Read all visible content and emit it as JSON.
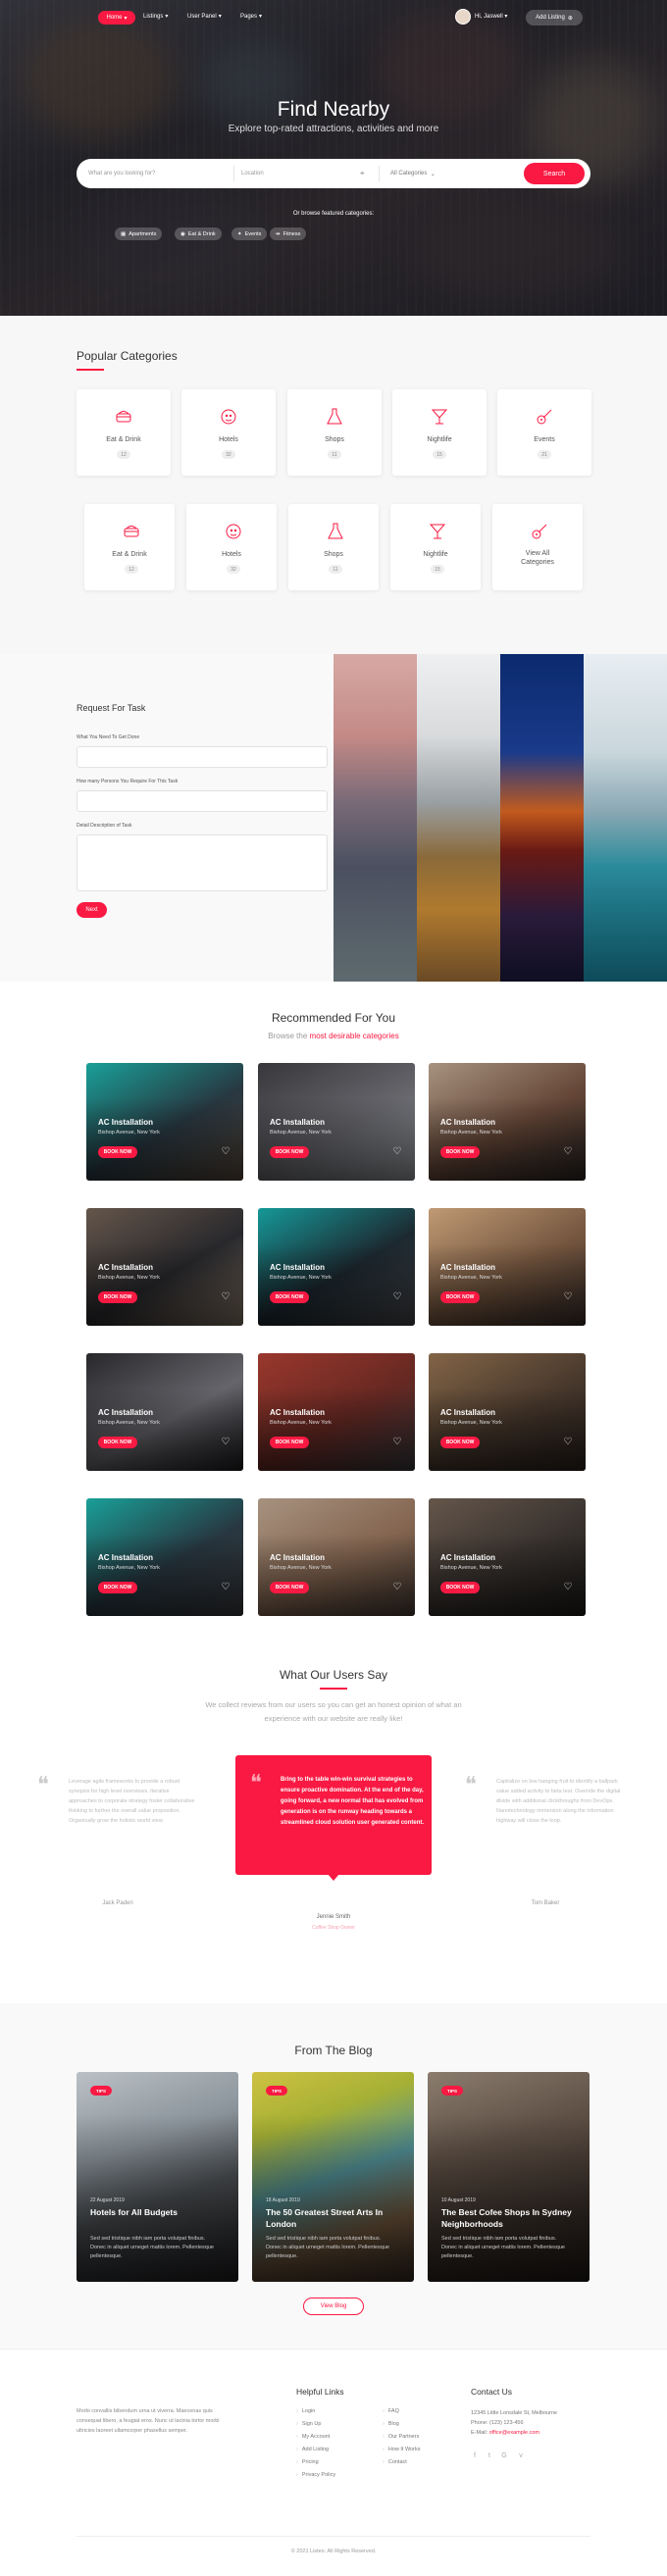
{
  "nav": {
    "home": "Home",
    "items": [
      "Listings",
      "User Panel",
      "Pages"
    ],
    "user": "Hi, Jaswell",
    "add_listing": "Add Listing"
  },
  "hero": {
    "title": "Find Nearby",
    "subtitle": "Explore top-rated attractions, activities and more",
    "search_placeholder": "What are you looking for?",
    "location_placeholder": "Location",
    "category_select": "All Categories",
    "search_button": "Search",
    "browse_label": "Or browse featured categories:",
    "chips": [
      "Apartments",
      "Eat & Drink",
      "Events",
      "Fitness"
    ]
  },
  "categories": {
    "title": "Popular Categories",
    "row1": [
      {
        "label": "Eat & Drink",
        "count": "12",
        "icon": "food-icon"
      },
      {
        "label": "Hotels",
        "count": "32",
        "icon": "hotel-icon"
      },
      {
        "label": "Shops",
        "count": "11",
        "icon": "shop-icon"
      },
      {
        "label": "Nightlife",
        "count": "15",
        "icon": "cocktail-icon"
      },
      {
        "label": "Events",
        "count": "21",
        "icon": "guitar-icon"
      }
    ],
    "row2": [
      {
        "label": "Eat & Drink",
        "count": "12",
        "icon": "food-icon"
      },
      {
        "label": "Hotels",
        "count": "32",
        "icon": "hotel-icon"
      },
      {
        "label": "Shops",
        "count": "11",
        "icon": "shop-icon"
      },
      {
        "label": "Nightlife",
        "count": "15",
        "icon": "cocktail-icon"
      },
      {
        "label": "View All Categories",
        "count": "",
        "icon": "guitar-icon"
      }
    ]
  },
  "request": {
    "title": "Request For Task",
    "field1_label": "What You Need To Get Done",
    "field2_label": "How many Persons You Require For This Task",
    "field3_label": "Detail Description of Task",
    "next": "Next"
  },
  "recommended": {
    "title": "Recommended For You",
    "subtitle_plain": "Browse the",
    "subtitle_em": "most desirable categories",
    "card_title": "AC Installation",
    "card_location": "Bishop Avenue, New York",
    "card_button": "BOOK NOW"
  },
  "testimonials": {
    "title": "What Our Users Say",
    "subtitle": "We collect reviews from our users so you can get an honest opinion of what an experience with our website are really like!",
    "left_text": "Leverage agile frameworks to provide a robust synopsis for high level overviews. Iterative approaches to corporate strategy foster collaborative thinking to further the overall value proposition. Organically grow the holistic world view.",
    "middle_text": "Bring to the table win-win survival strategies to ensure proactive domination. At the end of the day, going forward, a new normal that has evolved from generation is on the runway heading towards a streamlined cloud solution user generated content.",
    "right_text": "Capitalize on low hanging fruit to identify a ballpark value added activity to beta test. Override the digital divide with additional clickthroughs from DevOps. Nanotechnology immersion along the information highway will close the loop.",
    "left_name": "Jack Paden",
    "middle_name": "Jennie Smith",
    "middle_role": "Coffee Shop Owner",
    "right_name": "Tom Baker"
  },
  "blog": {
    "title": "From The Blog",
    "tag": "TIPS",
    "posts": [
      {
        "date": "22 August 2019",
        "title": "Hotels for All Budgets",
        "excerpt": "Sed sed tristique nibh iam porta volutpat finibus. Donec in aliquet urneget mattis lorem. Pellentesque pellentesque."
      },
      {
        "date": "18 August 2019",
        "title": "The 50 Greatest Street Arts In London",
        "excerpt": "Sed sed tristique nibh iam porta volutpat finibus. Donec in aliquet urneget mattis lorem. Pellentesque pellentesque."
      },
      {
        "date": "10 August 2019",
        "title": "The Best Cofee Shops In Sydney Neighborhoods",
        "excerpt": "Sed sed tristique nibh iam porta volutpat finibus. Donec in aliquet urneget mattis lorem. Pellentesque pellentesque."
      }
    ],
    "view_blog": "View Blog"
  },
  "footer": {
    "about": "Morbi convallis bibendum urna ut viverra. Maecenas quis consequat libero, a feugiat eros. Nunc ut lacinia tortor morbi ultricies laoreet ullamcorper phasellus semper.",
    "helpful_title": "Helpful Links",
    "links_col1": [
      "Login",
      "Sign Up",
      "My Account",
      "Add Listing",
      "Pricing",
      "Privacy Policy"
    ],
    "links_col2": [
      "FAQ",
      "Blog",
      "Our Partners",
      "How It Works",
      "Contact"
    ],
    "contact_title": "Contact Us",
    "address": "12345 Little Lonsdale St, Melbourne",
    "phone": "Phone: (123) 123-456",
    "email_label": "E-Mail:",
    "email": "office@example.com",
    "copyright": "© 2021 Listeo. All Rights Reserved."
  },
  "colors": {
    "accent": "#f91942"
  }
}
